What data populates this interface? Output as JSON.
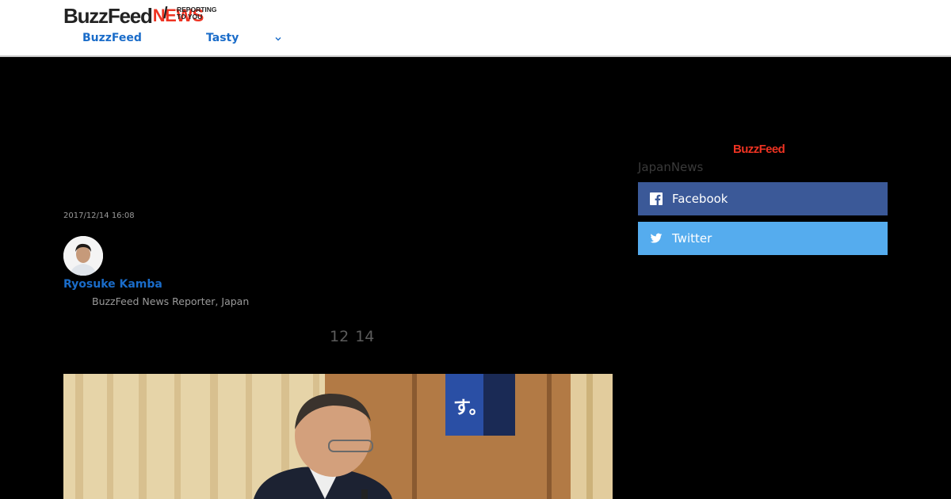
{
  "header": {
    "logo_main": "BuzzFeed",
    "logo_news": "NEWS",
    "logo_tagline_line1": "REPORTING",
    "logo_tagline_line2": "TO YOU",
    "nav": [
      {
        "label": "BuzzFeed"
      },
      {
        "label": "Tasty"
      }
    ]
  },
  "article": {
    "timestamp": "2017/12/14 16:08",
    "author_name": "Ryosuke Kamba",
    "author_title": "BuzzFeed News Reporter, Japan",
    "number_text": "12 14"
  },
  "sidebar": {
    "logo": "BuzzFeed",
    "label": "JapanNews",
    "share": [
      {
        "label": "Facebook",
        "icon": "facebook-icon",
        "color": "#3b5998"
      },
      {
        "label": "Twitter",
        "icon": "twitter-icon",
        "color": "#55acee"
      }
    ]
  },
  "colors": {
    "accent": "#1a6cc9",
    "brand_red": "#e32",
    "background": "#000000"
  }
}
